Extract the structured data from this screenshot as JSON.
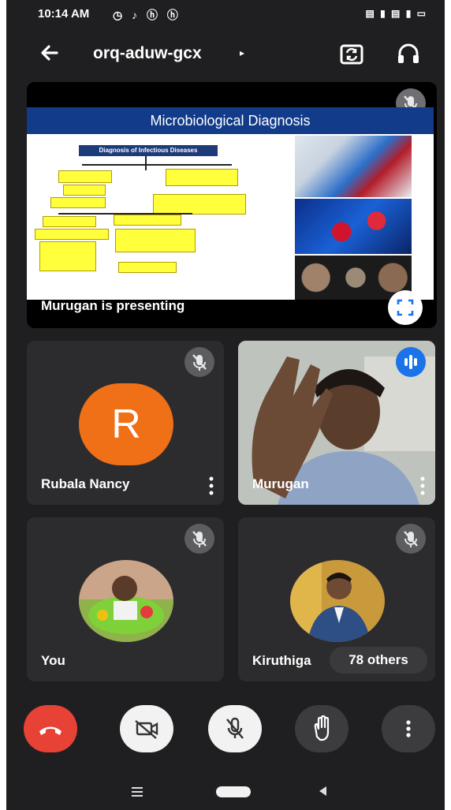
{
  "status_bar": {
    "time": "10:14 AM",
    "left_icons": "◷ ♪ ⓗ ⓗ",
    "right_icons": "▤ ▮ ▤ ▮ ▭"
  },
  "header": {
    "meeting_code": "orq-aduw-gcx",
    "caret": "▸"
  },
  "presentation": {
    "slide_title": "Microbiological Diagnosis",
    "diagram_heading": "Diagnosis of Infectious Diseases",
    "presenter_label": "Murugan is presenting"
  },
  "participants": [
    {
      "name": "Rubala Nancy",
      "initial": "R",
      "avatar_color": "#ef7016",
      "muted": true
    },
    {
      "name": "Murugan",
      "speaking": true
    },
    {
      "name": "You",
      "muted": true
    },
    {
      "name": "Kiruthiga",
      "muted": true
    }
  ],
  "others_label": "78 others",
  "colors": {
    "end_call": "#e84135",
    "background": "#1f1f21",
    "tile": "#2c2c2e",
    "speaking_badge": "#1a73e8"
  },
  "icons": [
    "back-arrow-icon",
    "switch-camera-icon",
    "headset-icon",
    "mic-off-icon",
    "fullscreen-icon",
    "more-vert-icon",
    "speaking-icon",
    "end-call-icon",
    "camera-off-icon",
    "raise-hand-icon"
  ]
}
